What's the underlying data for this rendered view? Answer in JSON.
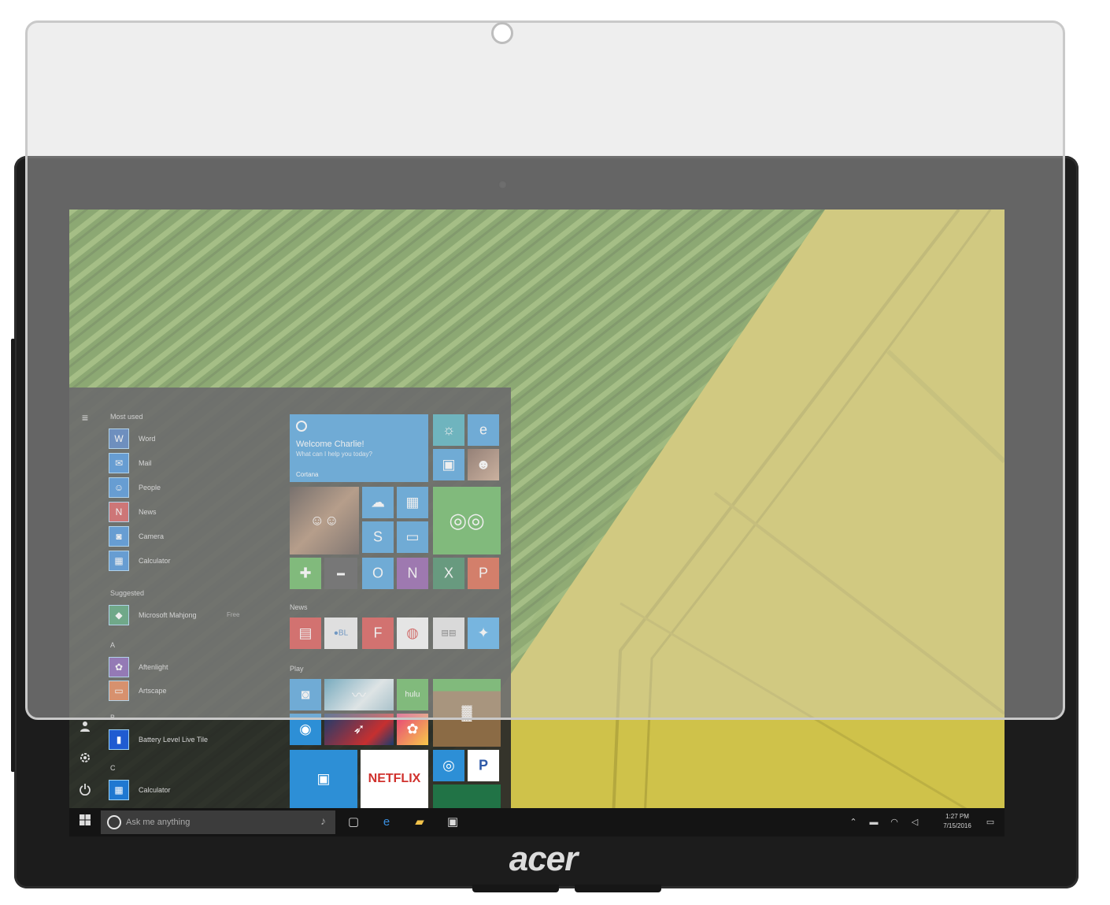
{
  "device": {
    "brand": "acer"
  },
  "start_menu": {
    "hamburger_icon": "≡",
    "most_used_label": "Most used",
    "most_used": [
      {
        "label": "Word",
        "glyph": "W",
        "color": "#2b62b0"
      },
      {
        "label": "Mail",
        "glyph": "✉",
        "color": "#1f78d1"
      },
      {
        "label": "People",
        "glyph": "☺",
        "color": "#1f78d1"
      },
      {
        "label": "News",
        "glyph": "N",
        "color": "#c8383a"
      },
      {
        "label": "Camera",
        "glyph": "◙",
        "color": "#1f78d1"
      },
      {
        "label": "Calculator",
        "glyph": "▦",
        "color": "#1f78d1"
      }
    ],
    "suggested_label": "Suggested",
    "suggested": [
      {
        "label": "Microsoft Mahjong",
        "extra": "Free",
        "glyph": "◆",
        "color": "#2e8b57"
      }
    ],
    "letter_a": "A",
    "a_apps": [
      {
        "label": "Aftenlight",
        "glyph": "✿",
        "color": "#6a3ea1"
      },
      {
        "label": "Artscape",
        "glyph": "▭",
        "color": "#d9652a"
      }
    ],
    "letter_b": "B",
    "b_apps": [
      {
        "label": "Battery Level Live Tile",
        "glyph": "▮",
        "color": "#1f5bd1"
      }
    ],
    "letter_c": "C",
    "c_apps": [
      {
        "label": "Calculator",
        "glyph": "▦",
        "color": "#1f78d1"
      }
    ],
    "rail_icons": [
      "user-icon",
      "settings-icon",
      "power-icon"
    ],
    "tiles": {
      "welcome_title": "Welcome Charlie!",
      "welcome_sub": "What can I help you today?",
      "welcome_caption": "Cortana",
      "news_label": "News",
      "play_label": "Play",
      "netflix_label": "NETFLIX",
      "pandora_label": "P",
      "colors": {
        "blue": "#2d8fd6",
        "teal": "#2c9fb0",
        "green": "#4aa841",
        "orange": "#d24726",
        "purple": "#7b3d98",
        "darkgreen": "#217346",
        "red": "#d0312d",
        "gray": "#5a5a5a"
      }
    }
  },
  "taskbar": {
    "search_placeholder": "Ask me anything",
    "clock_time": "1:27 PM",
    "clock_date": "7/15/2016"
  }
}
